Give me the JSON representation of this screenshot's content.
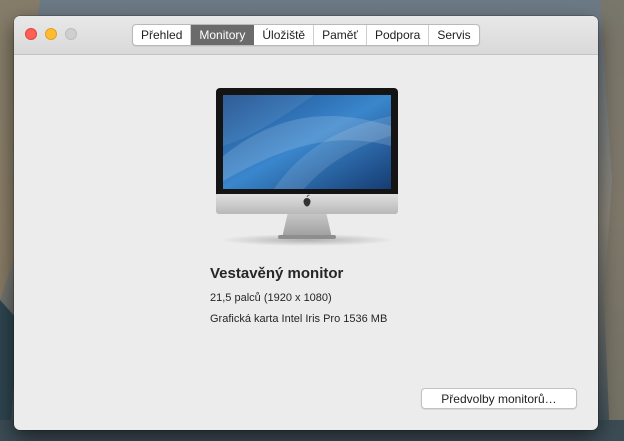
{
  "window": {
    "tabs": [
      {
        "label": "Přehled"
      },
      {
        "label": "Monitory"
      },
      {
        "label": "Úložiště"
      },
      {
        "label": "Paměť"
      },
      {
        "label": "Podpora"
      },
      {
        "label": "Servis"
      }
    ],
    "active_tab": "Monitory"
  },
  "display": {
    "name": "Vestavěný monitor",
    "size": "21,5 palců (1920 x 1080)",
    "graphics": "Grafická karta Intel Iris Pro 1536 MB"
  },
  "buttons": {
    "display_prefs": "Předvolby monitorů…"
  },
  "icons": {
    "monitor": "imac-monitor-icon",
    "apple": "apple-logo-icon"
  },
  "colors": {
    "close": "#fe5f57",
    "minimize": "#febc2e",
    "zoom_disabled": "#cfcfcf",
    "active_tab": "#6b6b6b"
  }
}
